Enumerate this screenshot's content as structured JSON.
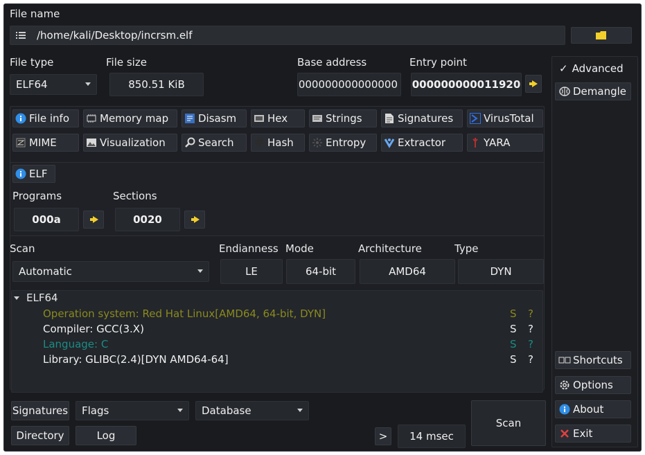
{
  "file_name": {
    "label": "File name",
    "path": "/home/kali/Desktop/incrsm.elf"
  },
  "file_type": {
    "label": "File type",
    "value": "ELF64"
  },
  "file_size": {
    "label": "File size",
    "value": "850.51 KiB"
  },
  "base_address": {
    "label": "Base address",
    "value": "0000000000000000"
  },
  "entry_point": {
    "label": "Entry point",
    "value": "000000000011920"
  },
  "side": {
    "advanced": "Advanced",
    "advanced_check": "✓",
    "demangle": "Demangle",
    "shortcuts": "Shortcuts",
    "options": "Options",
    "about": "About",
    "exit": "Exit"
  },
  "tools": {
    "row1": [
      "File info",
      "Memory map",
      "Disasm",
      "Hex",
      "Strings",
      "Signatures",
      "VirusTotal"
    ],
    "row2": [
      "MIME",
      "Visualization",
      "Search",
      "Hash",
      "Entropy",
      "Extractor",
      "YARA"
    ]
  },
  "elf": {
    "tab": "ELF",
    "programs_label": "Programs",
    "programs_value": "000a",
    "sections_label": "Sections",
    "sections_value": "0020"
  },
  "scan": {
    "label": "Scan",
    "mode_value": "Automatic",
    "endianness_label": "Endianness",
    "endianness_value": "LE",
    "mode_label": "Mode",
    "bits_value": "64-bit",
    "arch_label": "Architecture",
    "arch_value": "AMD64",
    "type_label": "Type",
    "type_value": "DYN"
  },
  "results": {
    "root": "ELF64",
    "items": [
      {
        "text": "Operation system: Red Hat Linux[AMD64, 64-bit, DYN]",
        "s": "S",
        "q": "?",
        "color": "#8a8a1e"
      },
      {
        "text": "Compiler: GCC(3.X)",
        "s": "S",
        "q": "?",
        "color": "#f0f0f0"
      },
      {
        "text": "Language: C",
        "s": "S",
        "q": "?",
        "color": "#1c8c84"
      },
      {
        "text": "Library: GLIBC(2.4)[DYN AMD64-64]",
        "s": "S",
        "q": "?",
        "color": "#f0f0f0"
      }
    ]
  },
  "bottom": {
    "signatures": "Signatures",
    "flags": "Flags",
    "database": "Database",
    "directory": "Directory",
    "log": "Log",
    "more": ">",
    "time": "14 msec",
    "scan": "Scan"
  },
  "colors": {
    "accent_yellow": "#f2cf2a",
    "info_blue": "#2f8ee8",
    "exit_red": "#e04040"
  }
}
